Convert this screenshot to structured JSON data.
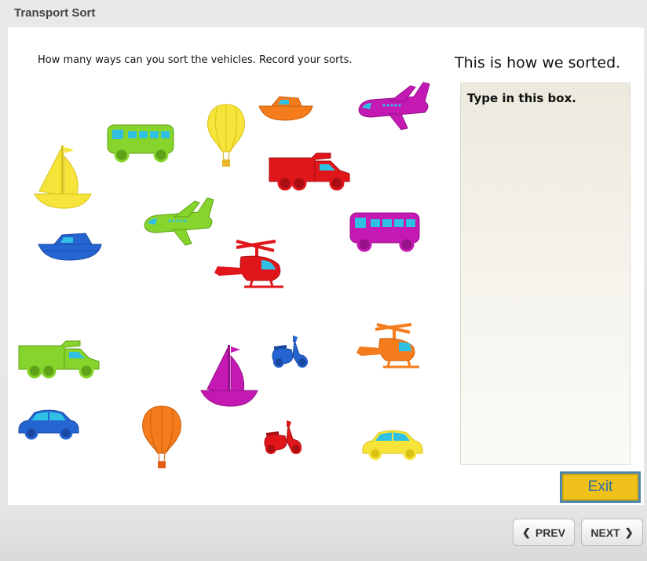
{
  "window": {
    "title": "Transport Sort"
  },
  "slide": {
    "instructions": "How many ways can you sort the vehicles. Record your sorts.",
    "sorted_title": "This is how we sorted.",
    "notes_box": {
      "value": "Type in this box."
    },
    "exit_label": "Exit"
  },
  "navigation": {
    "prev_label": "PREV",
    "next_label": "NEXT",
    "prev_icon": "chevron-left-icon",
    "next_icon": "chevron-right-icon"
  },
  "colors": {
    "yellow": "#f7e43a",
    "green": "#86d42c",
    "orange": "#f57c1c",
    "magenta": "#c419b3",
    "red": "#e0161b",
    "blue": "#2565d2",
    "exit_button": "#f0c01b",
    "window_icon": "#34c6e8"
  },
  "vehicles": [
    "sailboat",
    "bus",
    "hot-air-balloon",
    "speedboat",
    "airplane",
    "truck",
    "airplane",
    "speedboat",
    "bus",
    "helicopter",
    "truck",
    "scooter",
    "sailboat",
    "helicopter",
    "car",
    "hot-air-balloon",
    "scooter",
    "car"
  ]
}
